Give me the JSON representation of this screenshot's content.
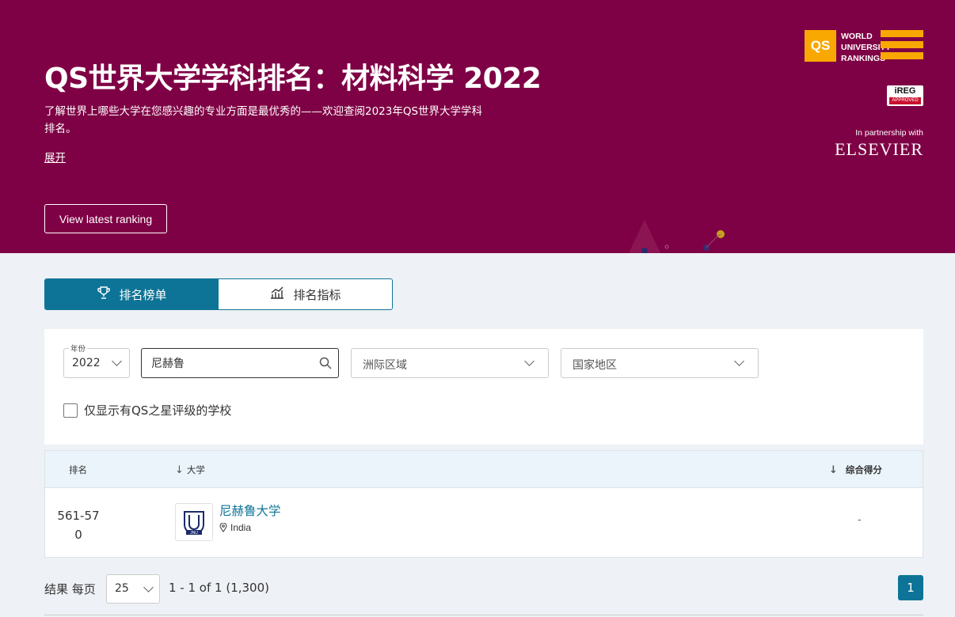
{
  "hero": {
    "title": "QS世界大学学科排名：材料科学 2022",
    "description": "了解世界上哪些大学在您感兴趣的专业方面是最优秀的——欢迎查阅2023年QS世界大学学科排名。",
    "expand_label": "展开",
    "latest_button": "View latest ranking",
    "logo": {
      "badge": "QS",
      "line1": "WORLD",
      "line2": "UNIVERSITY",
      "line3": "RANKINGS"
    },
    "ireg": {
      "top": "iREG",
      "bottom": "APPROVED"
    },
    "partnership": "In partnership with",
    "elsevier": "ELSEVIER"
  },
  "tabs": [
    {
      "label": "排名榜单",
      "icon": "trophy-icon",
      "active": true
    },
    {
      "label": "排名指标",
      "icon": "chart-icon",
      "active": false
    }
  ],
  "filters": {
    "year_label": "年份",
    "year_value": "2022",
    "search_value": "尼赫鲁",
    "region_placeholder": "洲际区域",
    "country_placeholder": "国家地区",
    "stars_checkbox_label": "仅显示有QS之星评级的学校"
  },
  "table": {
    "headers": {
      "rank": "排名",
      "university": "大学",
      "score": "综合得分"
    },
    "rows": [
      {
        "rank": "561-570",
        "name": "尼赫鲁大学",
        "country": "India",
        "score": "-",
        "logo_text": "JNU"
      }
    ]
  },
  "pagination": {
    "results_label": "结果 每页",
    "per_page": "25",
    "summary": "1 - 1 of 1 (1,300)",
    "current_page": "1"
  },
  "colors": {
    "hero_bg": "#7f0145",
    "accent": "#0e7497",
    "qs_orange": "#f8a800"
  }
}
